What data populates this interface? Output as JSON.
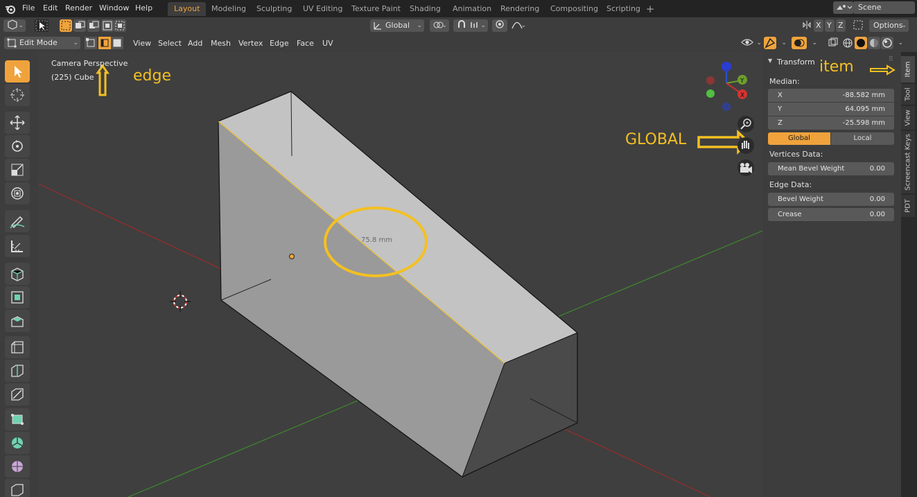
{
  "menu": {
    "file": "File",
    "edit": "Edit",
    "render": "Render",
    "window": "Window",
    "help": "Help"
  },
  "workspaces": [
    {
      "label": "Layout",
      "active": true
    },
    {
      "label": "Modeling"
    },
    {
      "label": "Sculpting"
    },
    {
      "label": "UV Editing"
    },
    {
      "label": "Texture Paint"
    },
    {
      "label": "Shading"
    },
    {
      "label": "Animation"
    },
    {
      "label": "Rendering"
    },
    {
      "label": "Compositing"
    },
    {
      "label": "Scripting"
    }
  ],
  "add_workspace": "+",
  "scene": "Scene",
  "header": {
    "orientation": "Global",
    "axis_x": "X",
    "axis_y": "Y",
    "axis_z": "Z",
    "options": "Options",
    "mode": "Edit Mode",
    "view": "View",
    "select": "Select",
    "add": "Add",
    "mesh": "Mesh",
    "vertex": "Vertex",
    "edge": "Edge",
    "face": "Face",
    "uv": "UV"
  },
  "viewport": {
    "camera": "Camera Perspective",
    "object": "(225) Cube",
    "measure": "75.8 mm",
    "annot_edge": "edge",
    "annot_global": "GLOBAL",
    "annot_item": "item",
    "gizmo_x": "X",
    "gizmo_y": "Y"
  },
  "panel": {
    "title": "Transform",
    "median": "Median:",
    "x_label": "X",
    "x_value": "-88.582 mm",
    "y_label": "Y",
    "y_value": "64.095 mm",
    "z_label": "Z",
    "z_value": "-25.598 mm",
    "global": "Global",
    "local": "Local",
    "vertices_data": "Vertices Data:",
    "mean_bevel_weight": "Mean Bevel Weight",
    "mean_bevel_value": "0.00",
    "edge_data": "Edge Data:",
    "bevel_weight": "Bevel Weight",
    "bevel_value": "0.00",
    "crease": "Crease",
    "crease_value": "0.00"
  },
  "tabs": {
    "item": "Item",
    "tool": "Tool",
    "view": "View",
    "screencast": "Screencast Keys",
    "pdt": "PDT"
  },
  "colors": {
    "accent": "#f0a33c",
    "annotation": "#f4c022",
    "x_axis": "#9b2b2b",
    "y_axis": "#3f8a2d"
  }
}
